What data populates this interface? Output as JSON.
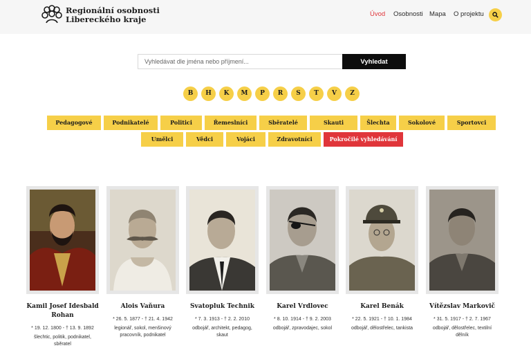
{
  "header": {
    "brand_line1": "Regionální osobnosti",
    "brand_line2": "Libereckého kraje",
    "nav": [
      "Úvod",
      "Osobnosti",
      "Mapa",
      "O projektu"
    ],
    "active_nav": "Úvod",
    "accent_color": "#e0353a",
    "search_icon": "search-icon"
  },
  "search": {
    "placeholder": "Vyhledávat dle jména nebo příjmení...",
    "value": "",
    "button_label": "Vyhledat"
  },
  "letters": [
    "B",
    "H",
    "K",
    "M",
    "P",
    "R",
    "S",
    "T",
    "V",
    "Z"
  ],
  "categories_row1": [
    "Pedagogové",
    "Podnikatelé",
    "Politici",
    "Řemeslníci",
    "Sběratelé",
    "Skauti",
    "Šlechta",
    "Sokolové",
    "Sportovci"
  ],
  "categories_row2": [
    "Umělci",
    "Vědci",
    "Vojáci",
    "Zdravotníci"
  ],
  "advanced_search_label": "Pokročilé vyhledávání",
  "yellow_color": "#f6cf48",
  "persons": [
    {
      "name": "Kamil Josef Idesbald Rohan",
      "dates": "* 19. 12. 1800 - † 13. 9. 1892",
      "professions": "šlechtic, politik, podnikatel, sběratel"
    },
    {
      "name": "Alois Vaňura",
      "dates": "* 26. 5. 1877 - † 21. 4. 1942",
      "professions": "legionář, sokol, menšinový pracovník, podnikatel"
    },
    {
      "name": "Svatopluk Technik",
      "dates": "* 7. 3. 1913 - † 2. 2. 2010",
      "professions": "odbojář, architekt, pedagog, skaut"
    },
    {
      "name": "Karel Vrdlovec",
      "dates": "* 8. 10. 1914 - † 9. 2. 2003",
      "professions": "odbojář, zpravodajec, sokol"
    },
    {
      "name": "Karel Benák",
      "dates": "* 22. 5. 1921 - † 10. 1. 1984",
      "professions": "odbojář, dělostřelec, tankista"
    },
    {
      "name": "Vítězslav Markovič",
      "dates": "* 31. 5. 1917 - † 2. 7. 1967",
      "professions": "odbojář, dělostřelec, textilní dělník"
    }
  ]
}
